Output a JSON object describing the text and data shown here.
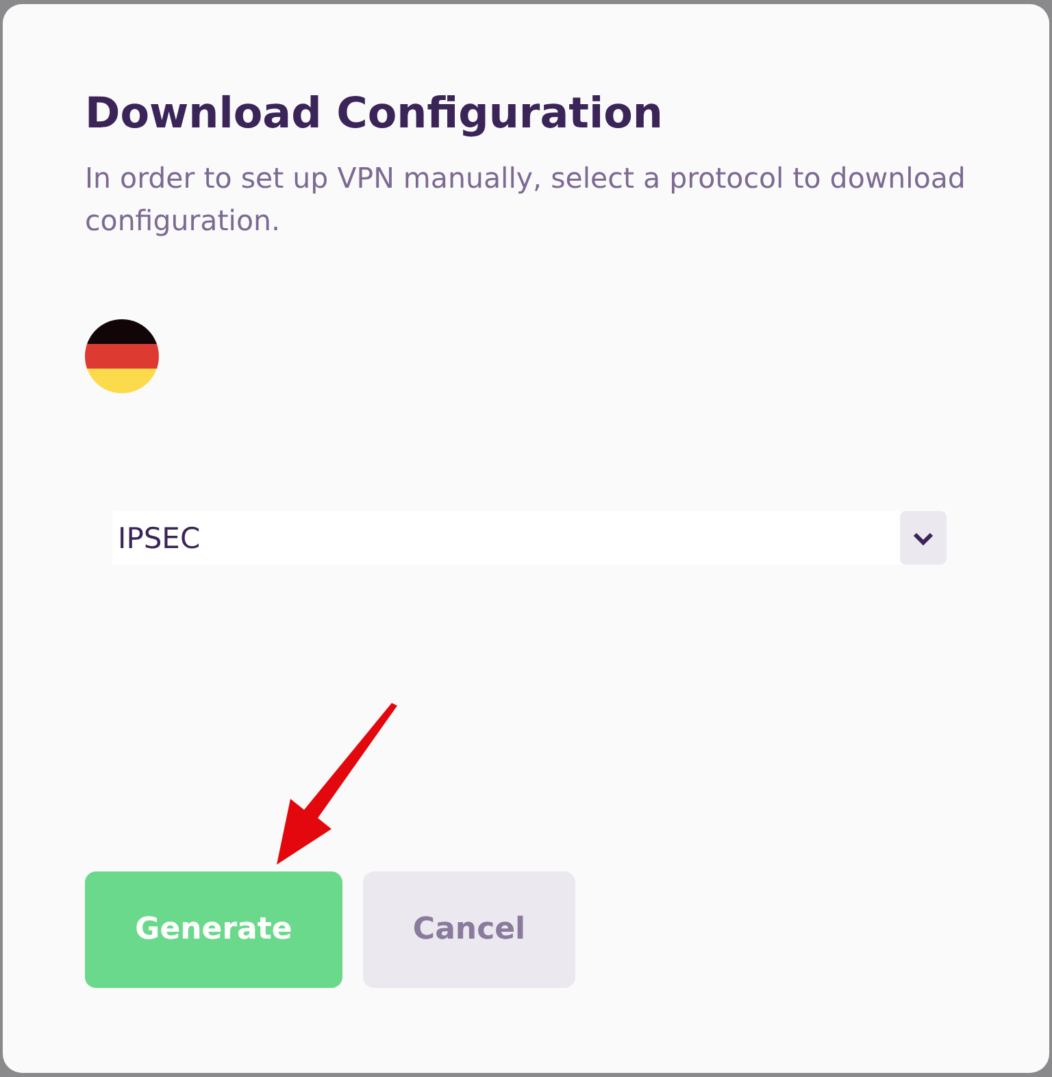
{
  "dialog": {
    "title": "Download Configuration",
    "description": "In order to set up VPN manually, select a protocol to download configuration.",
    "protocol_select": {
      "value": "IPSEC"
    },
    "buttons": [
      {
        "label": "Generate",
        "kind": "primary"
      },
      {
        "label": "Cancel",
        "kind": "secondary"
      }
    ]
  }
}
